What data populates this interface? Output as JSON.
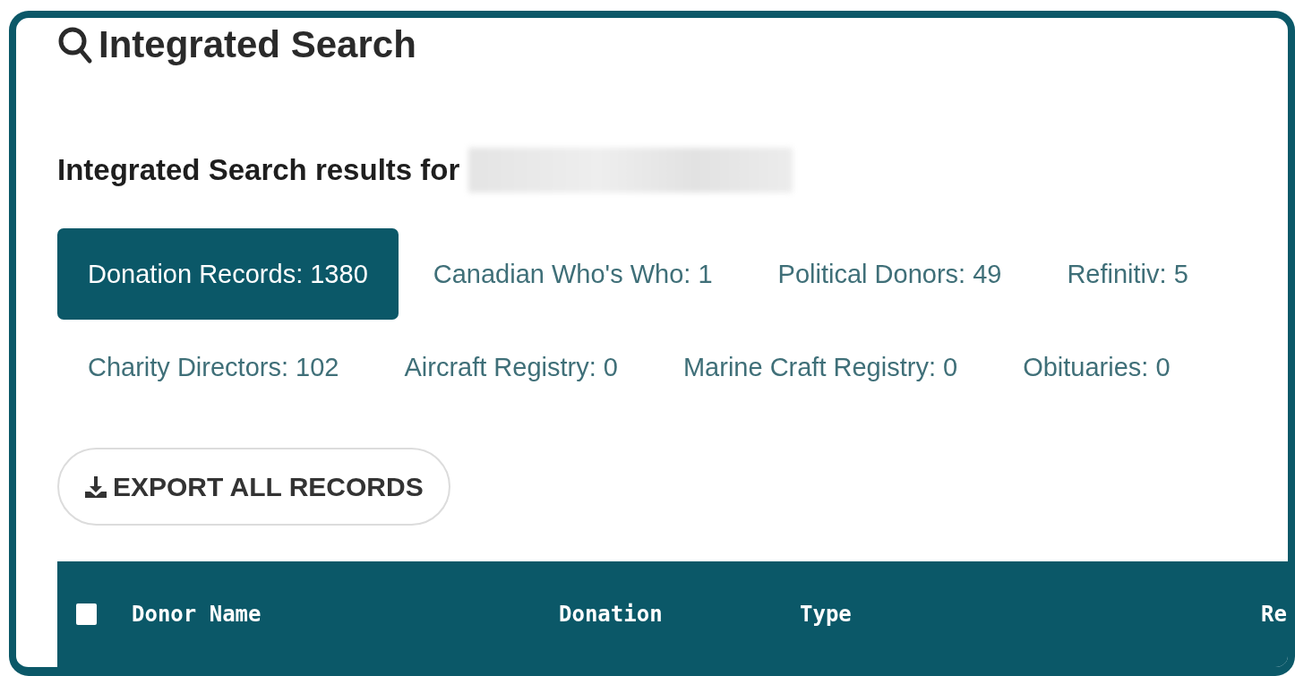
{
  "title": "Integrated Search",
  "results_heading": "Integrated Search results for",
  "tab_rows": [
    [
      {
        "label": "Donation Records: 1380",
        "selected": true
      },
      {
        "label": "Canadian Who's Who: 1",
        "selected": false
      },
      {
        "label": "Political Donors: 49",
        "selected": false
      },
      {
        "label": "Refinitiv: 5",
        "selected": false
      }
    ],
    [
      {
        "label": "Charity Directors: 102",
        "selected": false
      },
      {
        "label": "Aircraft Registry: 0",
        "selected": false
      },
      {
        "label": "Marine Craft Registry: 0",
        "selected": false
      },
      {
        "label": "Obituaries: 0",
        "selected": false
      }
    ]
  ],
  "export_button": "EXPORT ALL RECORDS",
  "table": {
    "select_all_checked": false,
    "columns": [
      "Donor Name",
      "Donation",
      "Type",
      "Re"
    ]
  }
}
